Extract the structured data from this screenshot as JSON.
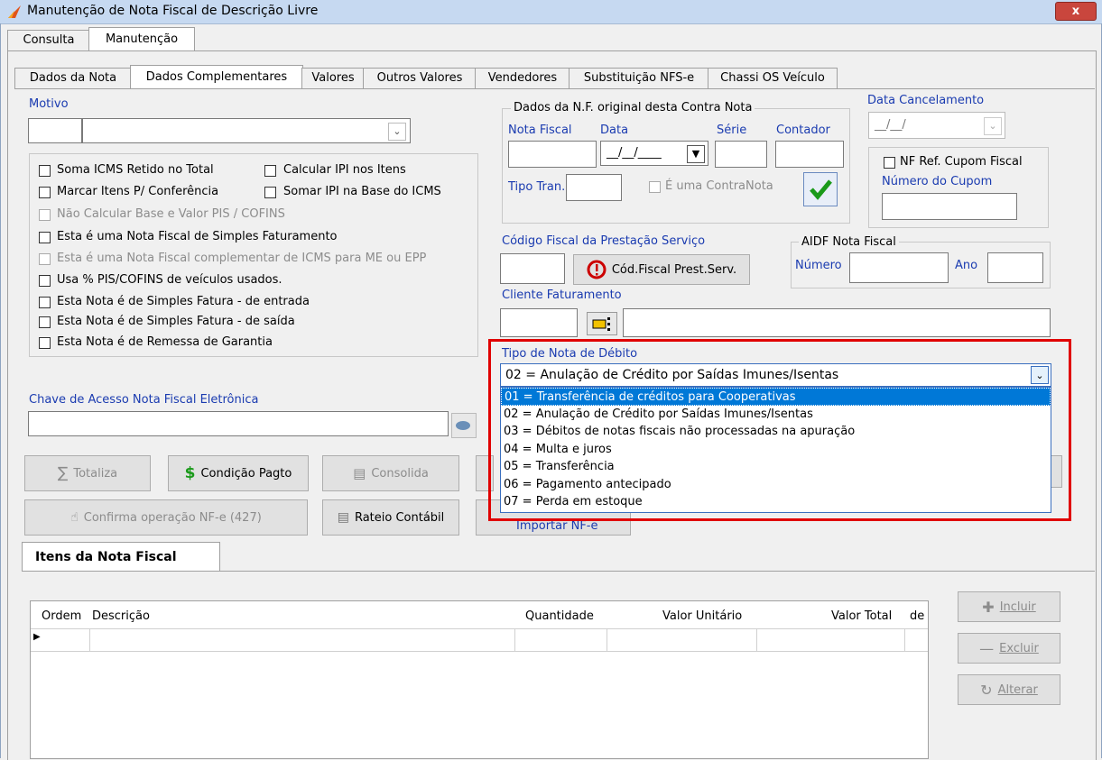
{
  "window": {
    "title": "Manutenção de Nota Fiscal de Descrição Livre",
    "close_glyph": "x"
  },
  "main_tabs": [
    "Consulta",
    "Manutenção"
  ],
  "sub_tabs": [
    "Dados da Nota",
    "Dados Complementares",
    "Valores",
    "Outros Valores",
    "Vendedores",
    "Substituição NFS-e",
    "Chassi OS Veículo"
  ],
  "motivo": {
    "label": "Motivo"
  },
  "checkboxes": {
    "soma_icms": "Soma ICMS Retido no Total",
    "calcular_ipi": "Calcular IPI nos Itens",
    "marcar_itens": "Marcar Itens P/ Conferência",
    "somar_ipi": "Somar IPI na Base do ICMS",
    "nao_calcular": "Não Calcular Base e Valor PIS / COFINS",
    "simples_faturamento": "Esta é uma Nota Fiscal de Simples Faturamento",
    "complementar": "Esta é uma Nota Fiscal complementar de ICMS para ME ou EPP",
    "usa_pis": "Usa % PIS/COFINS de veículos usados.",
    "simples_entrada": "Esta Nota é de Simples Fatura - de entrada",
    "simples_saida": "Esta Nota é de Simples Fatura - de saída",
    "remessa_garantia": "Esta Nota é de Remessa de Garantia"
  },
  "nf_original": {
    "title": "Dados da N.F. original desta Contra Nota",
    "nota_fiscal": "Nota Fiscal",
    "data": "Data",
    "serie": "Série",
    "contador": "Contador",
    "date_value": "__/__/____",
    "tipo_tran": "Tipo Tran.:",
    "contra_nota": "É uma ContraNota"
  },
  "cancelamento": {
    "label": "Data Cancelamento",
    "date_value": "__/__/",
    "nf_ref": "NF Ref. Cupom Fiscal",
    "numero_cupom": "Número do Cupom"
  },
  "codigo_fiscal": {
    "label": "Código Fiscal da Prestação Serviço",
    "button": "Cód.Fiscal Prest.Serv."
  },
  "aidf": {
    "title": "AIDF Nota Fiscal",
    "numero": "Número",
    "ano": "Ano"
  },
  "cliente": {
    "label": "Cliente Faturamento"
  },
  "tipo_debito": {
    "label": "Tipo de Nota de Débito",
    "selected": "02 = Anulação de Crédito por Saídas Imunes/Isentas",
    "options": [
      "01 = Transferência de créditos para Cooperativas",
      "02 = Anulação de Crédito por Saídas Imunes/Isentas",
      "03 = Débitos de notas fiscais não processadas na apuração",
      "04 = Multa e juros",
      "05 = Transferência",
      "06 = Pagamento antecipado",
      "07 = Perda em estoque"
    ]
  },
  "chave": {
    "label": "Chave de Acesso Nota Fiscal Eletrônica"
  },
  "buttons": {
    "totaliza": "Totaliza",
    "condicao": "Condição Pagto",
    "consolida": "Consolida",
    "confirma": "Confirma operação NF-e (427)",
    "rateio": "Rateio Contábil",
    "importar": "Importar NF-e",
    "incluir": "Incluir",
    "excluir": "Excluir",
    "alterar": "Alterar"
  },
  "itens": {
    "tab": "Itens da Nota Fiscal",
    "columns": [
      "Ordem",
      "Descrição",
      "Quantidade",
      "Valor Unitário",
      "Valor Total",
      "de"
    ]
  },
  "colors": {
    "highlight_red": "#e00000",
    "selection_blue": "#0078d7",
    "label_blue": "#1a3bb0"
  }
}
